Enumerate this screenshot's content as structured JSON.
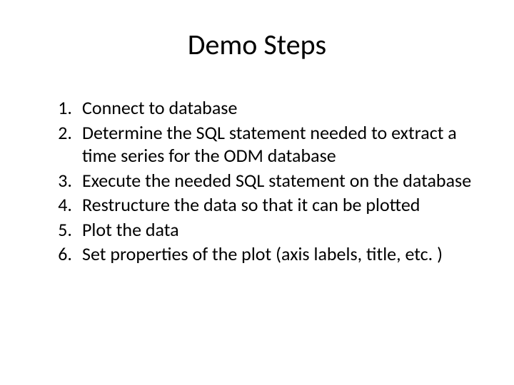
{
  "title": "Demo Steps",
  "steps": [
    {
      "n": "1.",
      "text": "Connect to database"
    },
    {
      "n": "2.",
      "text": "Determine the SQL statement needed to extract a time series for the ODM database"
    },
    {
      "n": "3.",
      "text": "Execute the needed SQL statement on the database"
    },
    {
      "n": "4.",
      "text": "Restructure the data so that it can be plotted"
    },
    {
      "n": "5.",
      "text": "Plot the data"
    },
    {
      "n": "6.",
      "text": "Set properties of the plot (axis labels, title, etc. )"
    }
  ]
}
